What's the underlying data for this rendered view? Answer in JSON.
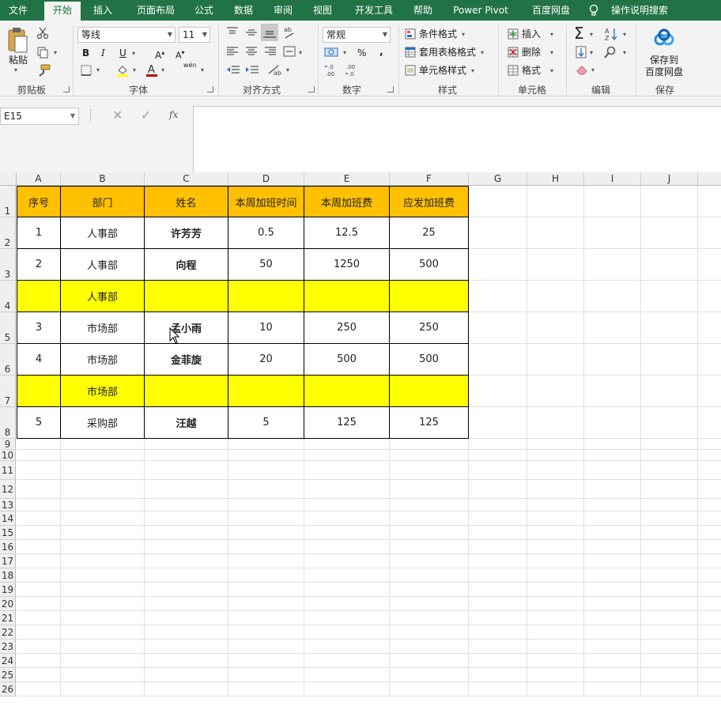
{
  "tabs": [
    "文件",
    "开始",
    "插入",
    "页面布局",
    "公式",
    "数据",
    "审阅",
    "视图",
    "开发工具",
    "帮助",
    "Power Pivot",
    "百度网盘",
    "操作说明搜索"
  ],
  "ribbon": {
    "clipboard": {
      "paste": "粘贴",
      "label": "剪贴板"
    },
    "font": {
      "name": "等线",
      "size": "11",
      "bold": "B",
      "italic": "I",
      "underline": "U",
      "grow": "A",
      "shrink": "A",
      "phonetic": "wén",
      "label": "字体"
    },
    "alignment": {
      "label": "对齐方式"
    },
    "number": {
      "format": "常规",
      "percent": "%",
      "comma": ",",
      "label": "数字"
    },
    "styles": {
      "conditional": "条件格式",
      "table": "套用表格格式",
      "cell": "单元格样式",
      "label": "样式"
    },
    "cells": {
      "insert": "插入",
      "delete": "删除",
      "format": "格式",
      "label": "单元格"
    },
    "editing": {
      "sum": "Σ",
      "label": "编辑"
    },
    "save": {
      "line1": "保存到",
      "line2": "百度网盘",
      "label": "保存"
    }
  },
  "formula_bar": {
    "name_box": "E15",
    "fx": "fx",
    "value": ""
  },
  "columns": [
    "A",
    "B",
    "C",
    "D",
    "E",
    "F",
    "G",
    "H",
    "I",
    "J"
  ],
  "rows": [
    "1",
    "2",
    "3",
    "4",
    "5",
    "6",
    "7",
    "8",
    "9",
    "10",
    "11",
    "12",
    "13",
    "14",
    "15",
    "16",
    "17",
    "18",
    "19",
    "20",
    "21",
    "22",
    "23",
    "24",
    "25",
    "26"
  ],
  "table": {
    "headers": [
      "序号",
      "部门",
      "姓名",
      "本周加班时间",
      "本周加班费",
      "应发加班费"
    ],
    "rows": [
      [
        "1",
        "人事部",
        "许芳芳",
        "0.5",
        "12.5",
        "25"
      ],
      [
        "2",
        "人事部",
        "向程",
        "50",
        "1250",
        "500"
      ],
      [
        "",
        "人事部",
        "",
        "",
        "",
        ""
      ],
      [
        "3",
        "市场部",
        "孟小雨",
        "10",
        "250",
        "250"
      ],
      [
        "4",
        "市场部",
        "金菲旋",
        "20",
        "500",
        "500"
      ],
      [
        "",
        "市场部",
        "",
        "",
        "",
        ""
      ],
      [
        "5",
        "采购部",
        "汪越",
        "5",
        "125",
        "125"
      ]
    ],
    "highlight_rows": [
      2,
      5
    ]
  },
  "colors": {
    "brand": "#217346",
    "header_fill": "#FFC000",
    "subtotal_fill": "#FFFF00"
  }
}
